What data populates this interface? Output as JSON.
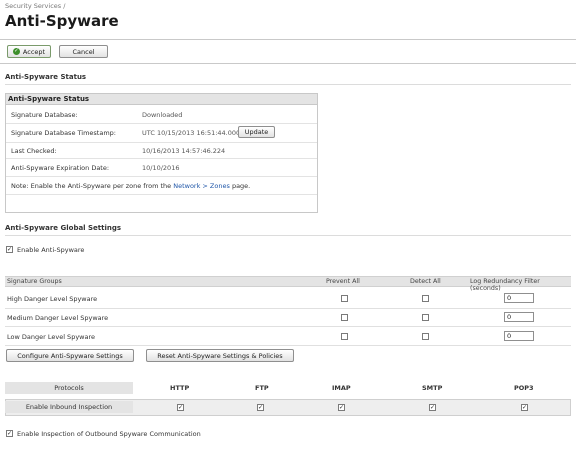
{
  "breadcrumb": "Security Services /",
  "page_title": "Anti-Spyware",
  "toolbar": {
    "accept_label": "Accept",
    "cancel_label": "Cancel"
  },
  "status_section": {
    "title": "Anti-Spyware Status",
    "box_title": "Anti-Spyware Status",
    "rows": [
      {
        "label": "Signature Database:",
        "value": "Downloaded"
      },
      {
        "label": "Signature Database Timestamp:",
        "value": "UTC 10/15/2013 16:51:44.000",
        "button": "Update"
      },
      {
        "label": "Last Checked:",
        "value": "10/16/2013 14:57:46.224"
      },
      {
        "label": "Anti-Spyware Expiration Date:",
        "value": "10/10/2016"
      }
    ],
    "note_prefix": "Note: Enable the Anti-Spyware per zone from the ",
    "note_link": "Network > Zones",
    "note_suffix": " page."
  },
  "global_settings": {
    "title": "Anti-Spyware Global Settings",
    "enable_label": "Enable Anti-Spyware",
    "enable_checked": true
  },
  "signature_groups": {
    "columns": [
      "Signature Groups",
      "Prevent All",
      "Detect All",
      "Log Redundancy Filter (seconds)"
    ],
    "rows": [
      {
        "name": "High Danger Level Spyware",
        "prevent": false,
        "detect": false,
        "filter": "0"
      },
      {
        "name": "Medium Danger Level Spyware",
        "prevent": false,
        "detect": false,
        "filter": "0"
      },
      {
        "name": "Low Danger Level Spyware",
        "prevent": false,
        "detect": false,
        "filter": "0"
      }
    ],
    "configure_button": "Configure Anti-Spyware Settings",
    "reset_button": "Reset Anti-Spyware Settings & Policies"
  },
  "protocols": {
    "header_label": "Protocols",
    "names": [
      "HTTP",
      "FTP",
      "IMAP",
      "SMTP",
      "POP3"
    ],
    "row_label": "Enable Inbound Inspection",
    "checked": [
      true,
      true,
      true,
      true,
      true
    ]
  },
  "outbound": {
    "label": "Enable Inspection of Outbound Spyware Communication",
    "checked": true
  },
  "colors": {
    "link": "#1f56a8",
    "accept_icon": "#3d8f2b",
    "header_bg": "#e4e4e4"
  }
}
